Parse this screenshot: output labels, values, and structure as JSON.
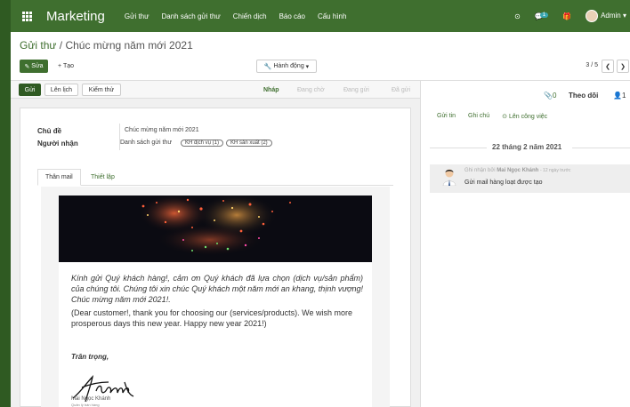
{
  "topbar": {
    "app_name": "Marketing",
    "menu": [
      "Gửi thư",
      "Danh sách gửi thư",
      "Chiến dịch",
      "Báo cáo",
      "Cấu hình"
    ],
    "msg_count": "1",
    "user": "Admin"
  },
  "breadcrumb": {
    "parent": "Gửi thư",
    "sep": "/",
    "current": "Chúc mừng năm mới 2021"
  },
  "buttons": {
    "edit": "Sửa",
    "create": "Tạo",
    "action": "Hành động",
    "send": "Gửi",
    "schedule": "Lên lịch",
    "test": "Kiểm thử"
  },
  "pager": {
    "value": "3 / 5"
  },
  "stages": [
    "Nháp",
    "Đang chờ",
    "Đang gửi",
    "Đã gửi"
  ],
  "form": {
    "subject_label": "Chủ đề",
    "subject": "Chúc mừng năm mới 2021",
    "recipients_label": "Người nhận",
    "recipients": "Danh sách gửi thư",
    "tags": [
      "KH dịch vụ (1)",
      "KH sản xuất (2)"
    ]
  },
  "tabs": [
    "Thân mail",
    "Thiết lập"
  ],
  "mail": {
    "vi": "Kính gửi Quý khách hàng!, cảm ơn Quý khách đã lựa chọn (dịch vụ/sản phẩm) của chúng tôi. Chúng tôi xin chúc Quý khách một năm mới an khang, thịnh vượng! Chúc mừng năm mới 2021!.",
    "en": "(Dear customer!, thank you for choosing our (services/products). We wish more prosperous days this new year. Happy new year 2021!)",
    "regards": "Trân trọng,",
    "signer": "Mai Ngọc Khánh",
    "signer_title": "Quản lý bán hàng"
  },
  "chatter": {
    "attachments": "0",
    "follow": "Theo dõi",
    "followers": "1",
    "actions": [
      "Gửi tin",
      "Ghi chú",
      "Lên công việc"
    ],
    "date": "22 tháng 2 năm 2021",
    "note_by": "Ghi nhận bởi",
    "author": "Mai Ngọc Khánh",
    "time": "- 12 ngày trước",
    "message": "Gửi mail hàng loạt được tạo"
  },
  "colors": {
    "brand": "#3f6f2f",
    "brand_dark": "#2f5a22"
  }
}
